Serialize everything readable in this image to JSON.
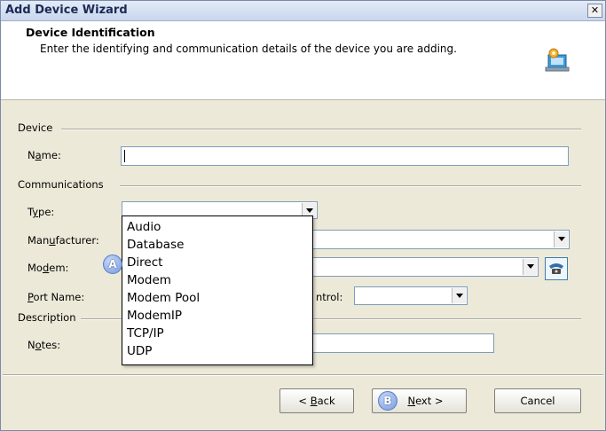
{
  "window": {
    "title": "Add Device Wizard",
    "close_glyph": "✕"
  },
  "header": {
    "title": "Device Identification",
    "subtitle": "Enter the identifying and communication details of the device you are adding.",
    "icon": "wizard-device-icon"
  },
  "groups": {
    "device": "Device",
    "communications": "Communications",
    "description": "Description"
  },
  "fields": {
    "name": {
      "label_pre": "N",
      "label_u": "a",
      "label_post": "me:",
      "value": ""
    },
    "type": {
      "label_pre": "T",
      "label_u": "y",
      "label_post": "pe:",
      "value": ""
    },
    "manufacturer": {
      "label_pre": "Man",
      "label_u": "u",
      "label_post": "facturer:",
      "value": ""
    },
    "modem": {
      "label_pre": "Mo",
      "label_u": "d",
      "label_post": "em:",
      "value": ""
    },
    "port_name": {
      "label_pre": "",
      "label_u": "P",
      "label_post": "ort Name:",
      "value": ""
    },
    "flow_control": {
      "label_visible": "ntrol:",
      "value": ""
    },
    "notes": {
      "label_pre": "N",
      "label_u": "o",
      "label_post": "tes:",
      "value": ""
    }
  },
  "type_dropdown": {
    "options": [
      "Audio",
      "Database",
      "Direct",
      "Modem",
      "Modem Pool",
      "ModemIP",
      "TCP/IP",
      "UDP"
    ]
  },
  "callouts": {
    "a": "A",
    "b": "B"
  },
  "buttons": {
    "back": {
      "pre": "< ",
      "u": "B",
      "post": "ack"
    },
    "next": {
      "pre": "",
      "u": "N",
      "post": "ext >"
    },
    "cancel": "Cancel"
  },
  "colors": {
    "title_text": "#1a2a55",
    "callout": "#6f93d9",
    "panel": "#ece9d8"
  }
}
